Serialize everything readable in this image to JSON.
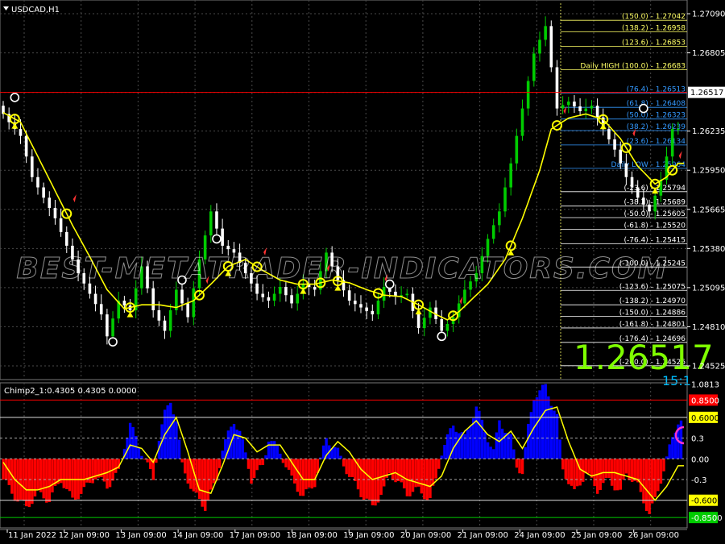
{
  "chart_data": {
    "type": "candlestick",
    "symbol_label": "USDCAD,H1",
    "current_price_label": "1.26517",
    "current_price": 1.26517,
    "big_price": "1.26517",
    "big_sub": "15:1",
    "watermark": "BEST-METATRADER-INDICATORS.COM",
    "price_axis": {
      "ylim": [
        1.24425,
        1.2719
      ],
      "ticks": [
        "1.27090",
        "1.26805",
        "1.26517",
        "1.26235",
        "1.25950",
        "1.25665",
        "1.25380",
        "1.25095",
        "1.24810",
        "1.24525"
      ]
    },
    "fib_levels": [
      {
        "text": "(150.0) - 1.27042",
        "price": 1.27042,
        "color": "#ffff66"
      },
      {
        "text": "(138.2) - 1.26958",
        "price": 1.26958,
        "color": "#ffff66"
      },
      {
        "text": "(123.6) - 1.26853",
        "price": 1.26853,
        "color": "#ffff66"
      },
      {
        "text": "Daily HIGH (100.0) - 1.26683",
        "price": 1.26683,
        "color": "#ffff66"
      },
      {
        "text": "(76.4) - 1.26513",
        "price": 1.26513,
        "color": "#3399ff"
      },
      {
        "text": "(61.8) - 1.26408",
        "price": 1.26408,
        "color": "#3399ff"
      },
      {
        "text": "(50.0) - 1.26323",
        "price": 1.26323,
        "color": "#3399ff"
      },
      {
        "text": "(38.2) - 1.26239",
        "price": 1.26239,
        "color": "#3399ff"
      },
      {
        "text": "(23.6) - 1.26134",
        "price": 1.26134,
        "color": "#3399ff"
      },
      {
        "text": "Daily LOW - 1.25964",
        "price": 1.25964,
        "color": "#3399ff"
      },
      {
        "text": "(-23.6) - 1.25794",
        "price": 1.25794,
        "color": "#ffffff"
      },
      {
        "text": "(-38.2) - 1.25689",
        "price": 1.25689,
        "color": "#ffffff"
      },
      {
        "text": "(-50.0) - 1.25605",
        "price": 1.25605,
        "color": "#ffffff"
      },
      {
        "text": "(-61.8) - 1.25520",
        "price": 1.2552,
        "color": "#ffffff"
      },
      {
        "text": "(-76.4) - 1.25415",
        "price": 1.25415,
        "color": "#ffffff"
      },
      {
        "text": "(-100.0) - 1.25245",
        "price": 1.25245,
        "color": "#ffffff"
      },
      {
        "text": "(-123.6) - 1.25075",
        "price": 1.25075,
        "color": "#ffffff"
      },
      {
        "text": "(-138.2) - 1.24970",
        "price": 1.2497,
        "color": "#ffffff"
      },
      {
        "text": "(-150.0) - 1.24886",
        "price": 1.24886,
        "color": "#ffffff"
      },
      {
        "text": "(-161.8) - 1.24801",
        "price": 1.24801,
        "color": "#ffffff"
      },
      {
        "text": "(-176.4) - 1.24696",
        "price": 1.24696,
        "color": "#ffffff"
      },
      {
        "text": "(-200.0) - 1.24526",
        "price": 1.24526,
        "color": "#ffffff"
      }
    ],
    "price_path": [
      [
        0,
        1.2642
      ],
      [
        2,
        1.263
      ],
      [
        4,
        1.262
      ],
      [
        6,
        1.259
      ],
      [
        8,
        1.2575
      ],
      [
        10,
        1.256
      ],
      [
        12,
        1.254
      ],
      [
        14,
        1.252
      ],
      [
        16,
        1.2505
      ],
      [
        18,
        1.249
      ],
      [
        19,
        1.2474
      ],
      [
        21,
        1.25
      ],
      [
        23,
        1.2493
      ],
      [
        25,
        1.2525
      ],
      [
        27,
        1.2493
      ],
      [
        29,
        1.2478
      ],
      [
        31,
        1.2508
      ],
      [
        33,
        1.2488
      ],
      [
        35,
        1.253
      ],
      [
        37,
        1.2565
      ],
      [
        39,
        1.254
      ],
      [
        41,
        1.2535
      ],
      [
        43,
        1.252
      ],
      [
        45,
        1.2505
      ],
      [
        47,
        1.25
      ],
      [
        49,
        1.251
      ],
      [
        51,
        1.2498
      ],
      [
        53,
        1.2512
      ],
      [
        55,
        1.2508
      ],
      [
        57,
        1.2535
      ],
      [
        59,
        1.2515
      ],
      [
        61,
        1.25
      ],
      [
        63,
        1.2495
      ],
      [
        65,
        1.249
      ],
      [
        67,
        1.251
      ],
      [
        69,
        1.2503
      ],
      [
        71,
        1.2505
      ],
      [
        73,
        1.248
      ],
      [
        75,
        1.2495
      ],
      [
        77,
        1.2478
      ],
      [
        79,
        1.2488
      ],
      [
        81,
        1.2508
      ],
      [
        83,
        1.252
      ],
      [
        85,
        1.2545
      ],
      [
        87,
        1.2565
      ],
      [
        89,
        1.26
      ],
      [
        91,
        1.264
      ],
      [
        93,
        1.268
      ],
      [
        95,
        1.27
      ],
      [
        97,
        1.264
      ],
      [
        99,
        1.2645
      ],
      [
        101,
        1.2638
      ],
      [
        103,
        1.2642
      ],
      [
        105,
        1.2625
      ],
      [
        107,
        1.261
      ],
      [
        109,
        1.259
      ],
      [
        111,
        1.2575
      ],
      [
        113,
        1.2565
      ],
      [
        115,
        1.2588
      ],
      [
        116,
        1.2605
      ],
      [
        117,
        1.2625
      ]
    ],
    "ma_path": [
      [
        0,
        1.2637
      ],
      [
        3,
        1.263
      ],
      [
        6,
        1.2605
      ],
      [
        9,
        1.258
      ],
      [
        12,
        1.2555
      ],
      [
        15,
        1.2532
      ],
      [
        18,
        1.2508
      ],
      [
        21,
        1.2494
      ],
      [
        24,
        1.2497
      ],
      [
        27,
        1.2497
      ],
      [
        30,
        1.2495
      ],
      [
        33,
        1.25
      ],
      [
        36,
        1.2512
      ],
      [
        39,
        1.2525
      ],
      [
        42,
        1.253
      ],
      [
        45,
        1.2522
      ],
      [
        48,
        1.2515
      ],
      [
        51,
        1.2512
      ],
      [
        54,
        1.2512
      ],
      [
        57,
        1.2515
      ],
      [
        60,
        1.2513
      ],
      [
        63,
        1.2508
      ],
      [
        66,
        1.2504
      ],
      [
        69,
        1.2503
      ],
      [
        72,
        1.2497
      ],
      [
        75,
        1.249
      ],
      [
        77,
        1.2486
      ],
      [
        79,
        1.2492
      ],
      [
        81,
        1.25
      ],
      [
        84,
        1.2512
      ],
      [
        87,
        1.253
      ],
      [
        90,
        1.256
      ],
      [
        93,
        1.2595
      ],
      [
        95,
        1.2625
      ],
      [
        98,
        1.2633
      ],
      [
        101,
        1.2636
      ],
      [
        104,
        1.2632
      ],
      [
        107,
        1.2618
      ],
      [
        110,
        1.2598
      ],
      [
        113,
        1.2585
      ],
      [
        115,
        1.259
      ],
      [
        117,
        1.26
      ]
    ],
    "dates": [
      "11 Jan 2022",
      "12 Jan 09:00",
      "13 Jan 09:00",
      "14 Jan 09:00",
      "17 Jan 09:00",
      "18 Jan 09:00",
      "19 Jan 09:00",
      "20 Jan 09:00",
      "21 Jan 09:00",
      "24 Jan 09:00",
      "25 Jan 09:00",
      "26 Jan 09:00"
    ],
    "oscillator": {
      "label": "Chimp2_1:0.4305 0.4305 0.0000",
      "ylim": [
        -1.0,
        1.1
      ],
      "levels": [
        {
          "text": "1.0813",
          "value": 1.0813,
          "color": "#ffffff",
          "bg": "#000000"
        },
        {
          "text": "0.8500",
          "value": 0.85,
          "color": "#ffffff",
          "bg": "#ff0000"
        },
        {
          "text": "0.6000",
          "value": 0.6,
          "color": "#000000",
          "bg": "#ffff00"
        },
        {
          "text": "0.3",
          "value": 0.3,
          "color": "#ffffff",
          "bg": "#000000"
        },
        {
          "text": "0.00",
          "value": 0.0,
          "color": "#ffffff",
          "bg": "#000000"
        },
        {
          "text": "-0.3",
          "value": -0.3,
          "color": "#ffffff",
          "bg": "#000000"
        },
        {
          "text": "-0.6000",
          "value": -0.6,
          "color": "#000000",
          "bg": "#ffff00"
        },
        {
          "text": "-0.8500",
          "value": -0.85,
          "color": "#ffffff",
          "bg": "#00cc00"
        }
      ],
      "histogram": [
        [
          0,
          -0.3
        ],
        [
          2,
          -0.55
        ],
        [
          4,
          -0.7
        ],
        [
          6,
          -0.5
        ],
        [
          8,
          -0.6
        ],
        [
          10,
          -0.3
        ],
        [
          12,
          -0.6
        ],
        [
          14,
          -0.45
        ],
        [
          16,
          -0.25
        ],
        [
          18,
          -0.4
        ],
        [
          20,
          -0.2
        ],
        [
          21,
          0.2
        ],
        [
          22,
          0.5
        ],
        [
          24,
          0.1
        ],
        [
          26,
          -0.3
        ],
        [
          27,
          0.3
        ],
        [
          28,
          0.65
        ],
        [
          29,
          0.85
        ],
        [
          30,
          0.55
        ],
        [
          31,
          -0.1
        ],
        [
          33,
          -0.5
        ],
        [
          35,
          -0.7
        ],
        [
          37,
          -0.3
        ],
        [
          38,
          0.15
        ],
        [
          40,
          0.55
        ],
        [
          41,
          0.4
        ],
        [
          42,
          0.05
        ],
        [
          43,
          -0.3
        ],
        [
          45,
          -0.1
        ],
        [
          46,
          0.3
        ],
        [
          48,
          0.1
        ],
        [
          50,
          -0.3
        ],
        [
          52,
          -0.55
        ],
        [
          54,
          -0.35
        ],
        [
          56,
          0.3
        ],
        [
          58,
          0.1
        ],
        [
          60,
          -0.25
        ],
        [
          62,
          -0.5
        ],
        [
          64,
          -0.7
        ],
        [
          66,
          -0.45
        ],
        [
          67,
          -0.2
        ],
        [
          68,
          -0.3
        ],
        [
          70,
          -0.5
        ],
        [
          72,
          -0.45
        ],
        [
          74,
          -0.6
        ],
        [
          75,
          -0.3
        ],
        [
          76,
          0.1
        ],
        [
          78,
          0.5
        ],
        [
          80,
          0.3
        ],
        [
          82,
          0.75
        ],
        [
          84,
          0.3
        ],
        [
          85,
          0.1
        ],
        [
          86,
          0.55
        ],
        [
          88,
          0.3
        ],
        [
          89,
          -0.1
        ],
        [
          90,
          -0.2
        ],
        [
          91,
          0.45
        ],
        [
          92,
          0.9
        ],
        [
          94,
          1.05
        ],
        [
          96,
          0.6
        ],
        [
          97,
          -0.15
        ],
        [
          99,
          -0.5
        ],
        [
          100,
          -0.35
        ],
        [
          101,
          -0.2
        ],
        [
          103,
          -0.45
        ],
        [
          105,
          -0.3
        ],
        [
          107,
          -0.5
        ],
        [
          108,
          -0.2
        ],
        [
          110,
          -0.4
        ],
        [
          112,
          -0.8
        ],
        [
          113,
          -0.6
        ],
        [
          114,
          -0.3
        ],
        [
          116,
          0.3
        ],
        [
          117,
          0.55
        ]
      ],
      "signal": [
        [
          0,
          -0.05
        ],
        [
          2,
          -0.3
        ],
        [
          4,
          -0.45
        ],
        [
          6,
          -0.45
        ],
        [
          8,
          -0.4
        ],
        [
          10,
          -0.3
        ],
        [
          12,
          -0.3
        ],
        [
          14,
          -0.3
        ],
        [
          16,
          -0.25
        ],
        [
          18,
          -0.2
        ],
        [
          20,
          -0.12
        ],
        [
          22,
          0.2
        ],
        [
          24,
          0.15
        ],
        [
          26,
          -0.05
        ],
        [
          28,
          0.35
        ],
        [
          30,
          0.6
        ],
        [
          32,
          0.1
        ],
        [
          34,
          -0.45
        ],
        [
          36,
          -0.5
        ],
        [
          38,
          -0.1
        ],
        [
          40,
          0.35
        ],
        [
          42,
          0.3
        ],
        [
          44,
          0.1
        ],
        [
          46,
          0.2
        ],
        [
          48,
          0.2
        ],
        [
          50,
          -0.05
        ],
        [
          52,
          -0.3
        ],
        [
          54,
          -0.3
        ],
        [
          56,
          0.05
        ],
        [
          58,
          0.25
        ],
        [
          60,
          0.1
        ],
        [
          62,
          -0.15
        ],
        [
          64,
          -0.3
        ],
        [
          66,
          -0.25
        ],
        [
          68,
          -0.2
        ],
        [
          70,
          -0.3
        ],
        [
          72,
          -0.35
        ],
        [
          74,
          -0.4
        ],
        [
          76,
          -0.25
        ],
        [
          78,
          0.15
        ],
        [
          80,
          0.4
        ],
        [
          82,
          0.55
        ],
        [
          84,
          0.35
        ],
        [
          86,
          0.25
        ],
        [
          88,
          0.4
        ],
        [
          90,
          0.15
        ],
        [
          92,
          0.45
        ],
        [
          94,
          0.7
        ],
        [
          96,
          0.75
        ],
        [
          98,
          0.25
        ],
        [
          100,
          -0.15
        ],
        [
          102,
          -0.25
        ],
        [
          104,
          -0.2
        ],
        [
          106,
          -0.2
        ],
        [
          108,
          -0.25
        ],
        [
          110,
          -0.3
        ],
        [
          112,
          -0.5
        ],
        [
          113,
          -0.6
        ],
        [
          115,
          -0.4
        ],
        [
          117,
          -0.1
        ]
      ]
    }
  },
  "colors": {
    "background": "#000000",
    "grid": "#4a4a4a",
    "bull": "#00cc00",
    "bear": "#ffffff",
    "ma": "#ffff00",
    "price_line": "#ff0000",
    "histogram_up": "#0000ff",
    "histogram_down": "#ff0000",
    "signal": "#ffff00",
    "big_price": "#7fff00",
    "axis_text": "#ffffff"
  }
}
